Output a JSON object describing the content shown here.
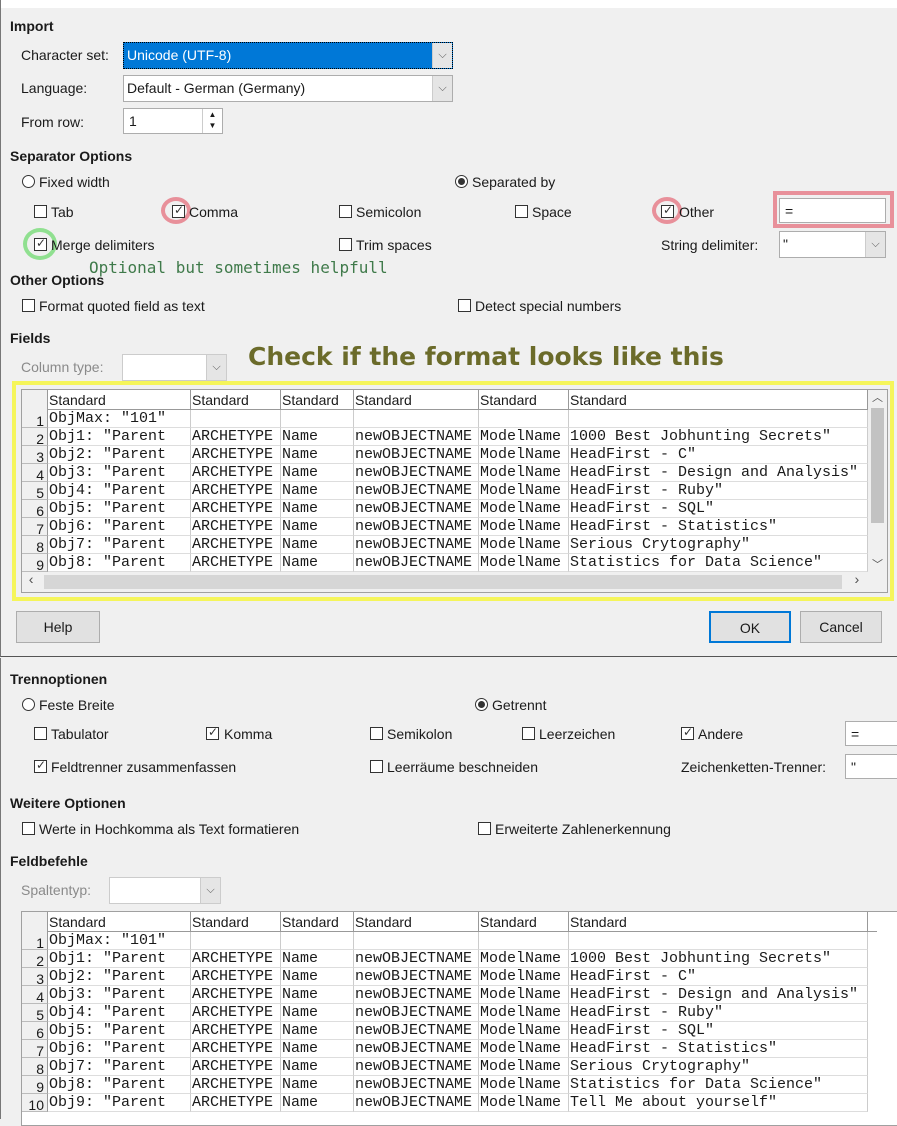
{
  "top": {
    "import_heading": "Import",
    "charset_label": "Character set:",
    "charset_value": "Unicode (UTF-8)",
    "language_label": "Language:",
    "language_value": "Default - German (Germany)",
    "from_row_label": "From row:",
    "from_row_value": "1",
    "separator_heading": "Separator Options",
    "fixed_width": {
      "label": "Fixed width",
      "checked": false
    },
    "separated_by": {
      "label": "Separated by",
      "checked": true
    },
    "tab": {
      "label": "Tab",
      "checked": false
    },
    "comma": {
      "label": "Comma",
      "checked": true
    },
    "semicolon": {
      "label": "Semicolon",
      "checked": false
    },
    "space": {
      "label": "Space",
      "checked": false
    },
    "other": {
      "label": "Other",
      "checked": true,
      "value": "="
    },
    "merge": {
      "label": "Merge delimiters",
      "checked": true
    },
    "trim": {
      "label": "Trim spaces",
      "checked": false
    },
    "string_delim_label": "String delimiter:",
    "string_delim_value": "\"",
    "annotation_merge": "Optional but sometimes helpfull",
    "other_heading": "Other Options",
    "quoted": {
      "label": "Format quoted field as text",
      "checked": false
    },
    "special": {
      "label": "Detect special numbers",
      "checked": false
    },
    "fields_heading": "Fields",
    "column_type_label": "Column type:",
    "annotation_fields": "Check if the format looks like this",
    "help": "Help",
    "ok": "OK",
    "cancel": "Cancel"
  },
  "bottom": {
    "separator_heading": "Trennoptionen",
    "fixed_width": {
      "label": "Feste Breite",
      "checked": false
    },
    "separated_by": {
      "label": "Getrennt",
      "checked": true
    },
    "tab": {
      "label": "Tabulator",
      "checked": false
    },
    "comma": {
      "label": "Komma",
      "checked": true
    },
    "semicolon": {
      "label": "Semikolon",
      "checked": false
    },
    "space": {
      "label": "Leerzeichen",
      "checked": false
    },
    "other": {
      "label": "Andere",
      "checked": true,
      "value": "="
    },
    "merge": {
      "label": "Feldtrenner zusammenfassen",
      "checked": true
    },
    "trim": {
      "label": "Leerräume beschneiden",
      "checked": false
    },
    "string_delim_label": "Zeichenketten-Trenner:",
    "string_delim_value": "\"",
    "other_heading": "Weitere Optionen",
    "quoted": {
      "label": "Werte in Hochkomma als Text formatieren",
      "checked": false
    },
    "special": {
      "label": "Erweiterte Zahlenerkennung",
      "checked": false
    },
    "fields_heading": "Feldbefehle",
    "column_type_label": "Spaltentyp:"
  },
  "table": {
    "headers": [
      "Standard",
      "Standard",
      "Standard",
      "Standard",
      "Standard",
      "Standard"
    ],
    "rows": [
      [
        "ObjMax: \"101\"",
        "",
        "",
        "",
        "",
        ""
      ],
      [
        "Obj1: \"Parent",
        "ARCHETYPE",
        "Name",
        "newOBJECTNAME",
        "ModelName",
        "1000 Best Jobhunting Secrets\""
      ],
      [
        "Obj2: \"Parent",
        "ARCHETYPE",
        "Name",
        "newOBJECTNAME",
        "ModelName",
        "HeadFirst - C\""
      ],
      [
        "Obj3: \"Parent",
        "ARCHETYPE",
        "Name",
        "newOBJECTNAME",
        "ModelName",
        "HeadFirst - Design and Analysis\""
      ],
      [
        "Obj4: \"Parent",
        "ARCHETYPE",
        "Name",
        "newOBJECTNAME",
        "ModelName",
        "HeadFirst - Ruby\""
      ],
      [
        "Obj5: \"Parent",
        "ARCHETYPE",
        "Name",
        "newOBJECTNAME",
        "ModelName",
        "HeadFirst - SQL\""
      ],
      [
        "Obj6: \"Parent",
        "ARCHETYPE",
        "Name",
        "newOBJECTNAME",
        "ModelName",
        "HeadFirst - Statistics\""
      ],
      [
        "Obj7: \"Parent",
        "ARCHETYPE",
        "Name",
        "newOBJECTNAME",
        "ModelName",
        "Serious Crytography\""
      ],
      [
        "Obj8: \"Parent",
        "ARCHETYPE",
        "Name",
        "newOBJECTNAME",
        "ModelName",
        "Statistics for Data Science\""
      ],
      [
        "Obj9: \"Parent",
        "ARCHETYPE",
        "Name",
        "newOBJECTNAME",
        "ModelName",
        "Tell Me about yourself\""
      ]
    ]
  },
  "colors": {
    "selection": "#0078d7",
    "highlight_red": "#e8909a",
    "highlight_green": "#90e090",
    "highlight_yellow": "#f5f55a",
    "annotation_text": "#6b6b2a"
  }
}
